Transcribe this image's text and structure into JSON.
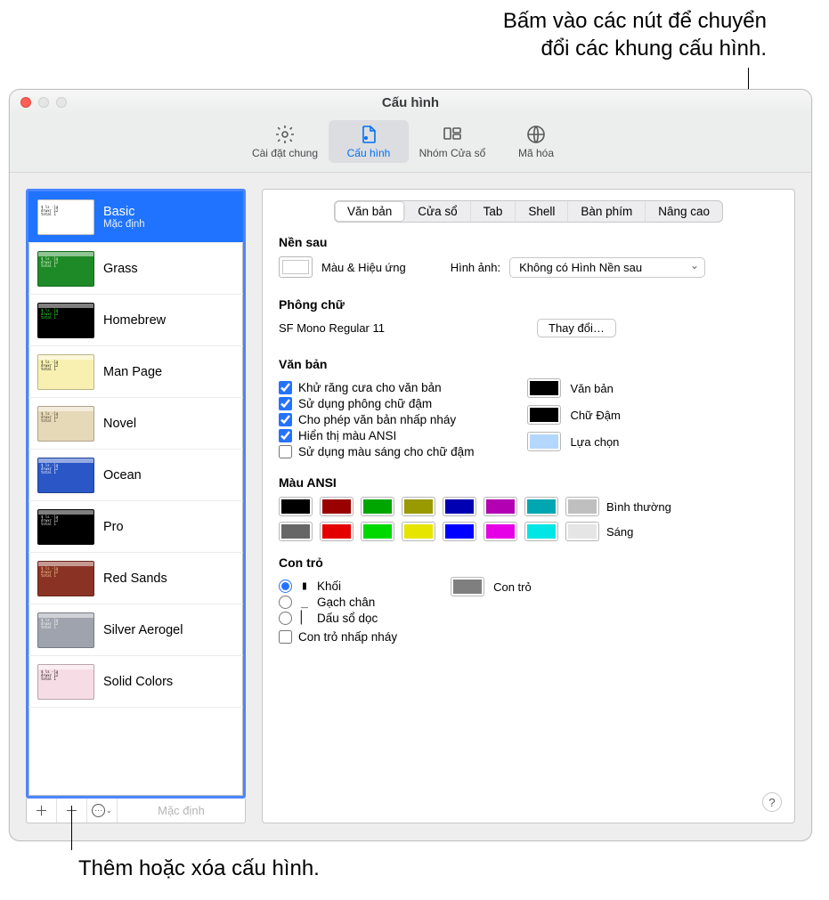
{
  "callouts": {
    "top": "Bấm vào các nút để chuyển\nđổi các khung cấu hình.",
    "bottom": "Thêm hoặc xóa cấu hình."
  },
  "window": {
    "title": "Cấu hình"
  },
  "toolbar": {
    "general": "Cài đặt chung",
    "profiles": "Cấu hình",
    "window_groups": "Nhóm Cửa sổ",
    "encoding": "Mã hóa"
  },
  "sidebar": {
    "profiles": [
      {
        "name": "Basic",
        "sub": "Mặc định",
        "selected": true,
        "bg": "#ffffff",
        "fg": "#000"
      },
      {
        "name": "Grass",
        "bg": "#1e8a27",
        "fg": "#efffe0"
      },
      {
        "name": "Homebrew",
        "bg": "#000000",
        "fg": "#29ff2f"
      },
      {
        "name": "Man Page",
        "bg": "#f7f0b1",
        "fg": "#000"
      },
      {
        "name": "Novel",
        "bg": "#e6d9b8",
        "fg": "#3a2e1a"
      },
      {
        "name": "Ocean",
        "bg": "#2a56c6",
        "fg": "#ffffff"
      },
      {
        "name": "Pro",
        "bg": "#000000",
        "fg": "#f2f2f2"
      },
      {
        "name": "Red Sands",
        "bg": "#8a3324",
        "fg": "#ffd9a0"
      },
      {
        "name": "Silver Aerogel",
        "bg": "#9ea3ad",
        "fg": "#ffffff"
      },
      {
        "name": "Solid Colors",
        "bg": "#f6dce4",
        "fg": "#000"
      }
    ],
    "footer_default": "Mặc định"
  },
  "tabs": {
    "text": "Văn bản",
    "window": "Cửa sổ",
    "tab": "Tab",
    "shell": "Shell",
    "keyboard": "Bàn phím",
    "advanced": "Nâng cao"
  },
  "background": {
    "title": "Nền sau",
    "color_effects": "Màu & Hiệu ứng",
    "image_label": "Hình ảnh:",
    "image_value": "Không có Hình Nền sau"
  },
  "font": {
    "title": "Phông chữ",
    "value": "SF Mono Regular 11",
    "change": "Thay đổi…"
  },
  "text": {
    "title": "Văn bản",
    "antialias": "Khử răng cưa cho văn bản",
    "bold": "Sử dụng phông chữ đậm",
    "blink": "Cho phép văn bản nhấp nháy",
    "ansi": "Hiển thị màu ANSI",
    "bright_bold": "Sử dụng màu sáng cho chữ đậm",
    "swatch_text": "Văn bản",
    "swatch_bold": "Chữ Đậm",
    "swatch_selection": "Lựa chọn",
    "colors": {
      "text": "#000000",
      "bold": "#000000",
      "selection": "#b4d7ff"
    }
  },
  "ansi": {
    "title": "Màu ANSI",
    "normal_label": "Bình thường",
    "bright_label": "Sáng",
    "normal": [
      "#000000",
      "#990000",
      "#00a600",
      "#999900",
      "#0000b2",
      "#b200b2",
      "#00a6b2",
      "#bfbfbf"
    ],
    "bright": [
      "#666666",
      "#e50000",
      "#00d900",
      "#e5e500",
      "#0000ff",
      "#e500e5",
      "#00e5e5",
      "#e5e5e5"
    ]
  },
  "cursor": {
    "title": "Con trỏ",
    "block": "Khối",
    "underline": "Gạch chân",
    "vbar": "Dấu sổ dọc",
    "blink": "Con trỏ nhấp nháy",
    "swatch_label": "Con trỏ",
    "color": "#7f7f7f"
  }
}
